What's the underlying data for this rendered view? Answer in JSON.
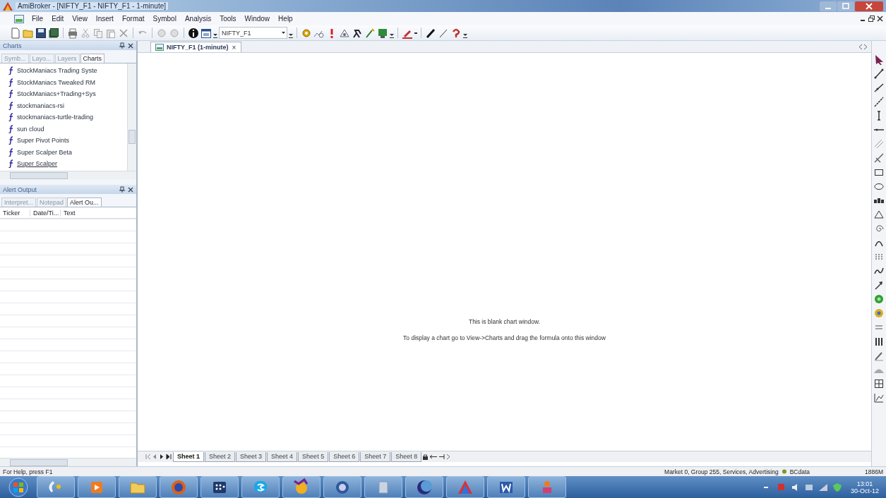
{
  "window": {
    "title": "AmiBroker - [NIFTY_F1 - NIFTY_F1 - 1-minute]"
  },
  "menu": [
    "File",
    "Edit",
    "View",
    "Insert",
    "Format",
    "Symbol",
    "Analysis",
    "Tools",
    "Window",
    "Help"
  ],
  "toolbar": {
    "symbol": "NIFTY_F1"
  },
  "charts_panel": {
    "title": "Charts",
    "tabs": [
      {
        "label": "Symb...",
        "selected": false
      },
      {
        "label": "Layo...",
        "selected": false
      },
      {
        "label": "Layers",
        "selected": false
      },
      {
        "label": "Charts",
        "selected": true
      }
    ],
    "items": [
      {
        "label": "StockManiacs Trading Syste",
        "selected": false
      },
      {
        "label": "StockManiacs Tweaked RM",
        "selected": false
      },
      {
        "label": "StockManiacs+Trading+Sys",
        "selected": false
      },
      {
        "label": "stockmaniacs-rsi",
        "selected": false
      },
      {
        "label": "stockmaniacs-turtle-trading",
        "selected": false
      },
      {
        "label": "sun cloud",
        "selected": false
      },
      {
        "label": "Super Pivot Points",
        "selected": false
      },
      {
        "label": "Super Scalper Beta",
        "selected": false
      },
      {
        "label": "Super Scalper",
        "selected": true
      }
    ]
  },
  "alert_panel": {
    "title": "Alert Output",
    "tabs": [
      {
        "label": "Interpret...",
        "selected": false
      },
      {
        "label": "Notepad",
        "selected": false
      },
      {
        "label": "Alert Ou...",
        "selected": true
      }
    ],
    "columns": [
      "Ticker",
      "Date/Ti...",
      "Text"
    ]
  },
  "document_tab": {
    "label": "NIFTY_F1 (1-minute)",
    "close": "×"
  },
  "chart_window": {
    "messages": [
      "This is blank chart window.",
      "To display a chart go to View->Charts and drag the formula onto this window"
    ]
  },
  "sheets": [
    {
      "label": "Sheet 1",
      "selected": true
    },
    {
      "label": "Sheet 2",
      "selected": false
    },
    {
      "label": "Sheet 3",
      "selected": false
    },
    {
      "label": "Sheet 4",
      "selected": false
    },
    {
      "label": "Sheet 5",
      "selected": false
    },
    {
      "label": "Sheet 6",
      "selected": false
    },
    {
      "label": "Sheet 7",
      "selected": false
    },
    {
      "label": "Sheet 8",
      "selected": false
    }
  ],
  "status_bar": {
    "help": "For Help, press F1",
    "market": "Market 0, Group 255, Services, Advertising",
    "source": "BCdata",
    "memory": "1886M"
  },
  "taskbar": {
    "time": "13:01",
    "date": "30-Oct-12"
  }
}
